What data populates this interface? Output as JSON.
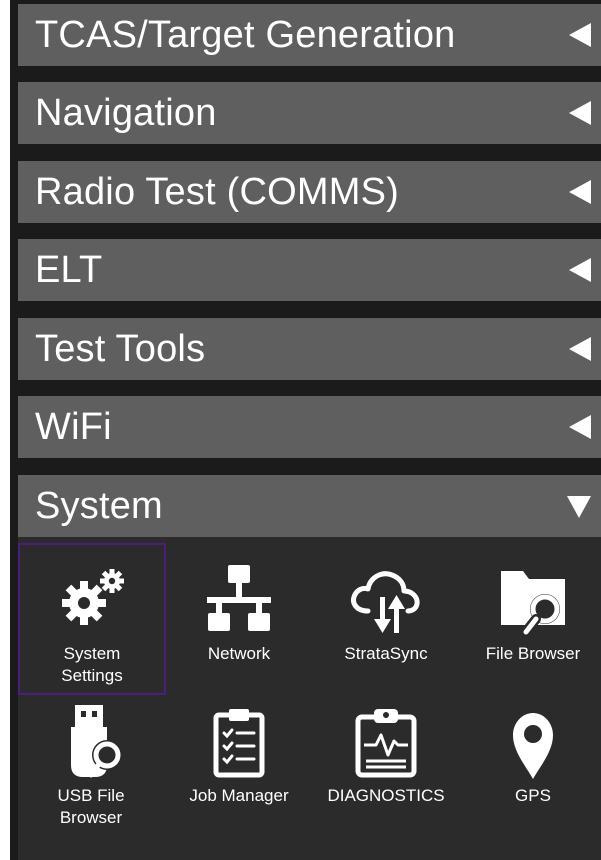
{
  "menu": {
    "items": [
      {
        "label": "TCAS/Target Generation",
        "state": "collapsed"
      },
      {
        "label": "Navigation",
        "state": "collapsed"
      },
      {
        "label": "Radio Test (COMMS)",
        "state": "collapsed"
      },
      {
        "label": "ELT",
        "state": "collapsed"
      },
      {
        "label": "Test Tools",
        "state": "collapsed"
      },
      {
        "label": "WiFi",
        "state": "collapsed"
      },
      {
        "label": "System",
        "state": "expanded"
      }
    ]
  },
  "system_apps": [
    {
      "label": "System\nSettings",
      "icon": "gears-icon",
      "selected": true
    },
    {
      "label": "Network",
      "icon": "network-icon",
      "selected": false
    },
    {
      "label": "StrataSync",
      "icon": "cloud-sync-icon",
      "selected": false
    },
    {
      "label": "File Browser",
      "icon": "folder-search-icon",
      "selected": false
    },
    {
      "label": "USB File\nBrowser",
      "icon": "usb-search-icon",
      "selected": false
    },
    {
      "label": "Job Manager",
      "icon": "clipboard-checklist-icon",
      "selected": false
    },
    {
      "label": "DIAGNOSTICS",
      "icon": "diagnostics-icon",
      "selected": false
    },
    {
      "label": "GPS",
      "icon": "map-pin-icon",
      "selected": false
    }
  ],
  "colors": {
    "row_bg": "#5f5f5f",
    "panel_bg": "#2b2b2b",
    "selected_border": "#4a1f7a"
  }
}
